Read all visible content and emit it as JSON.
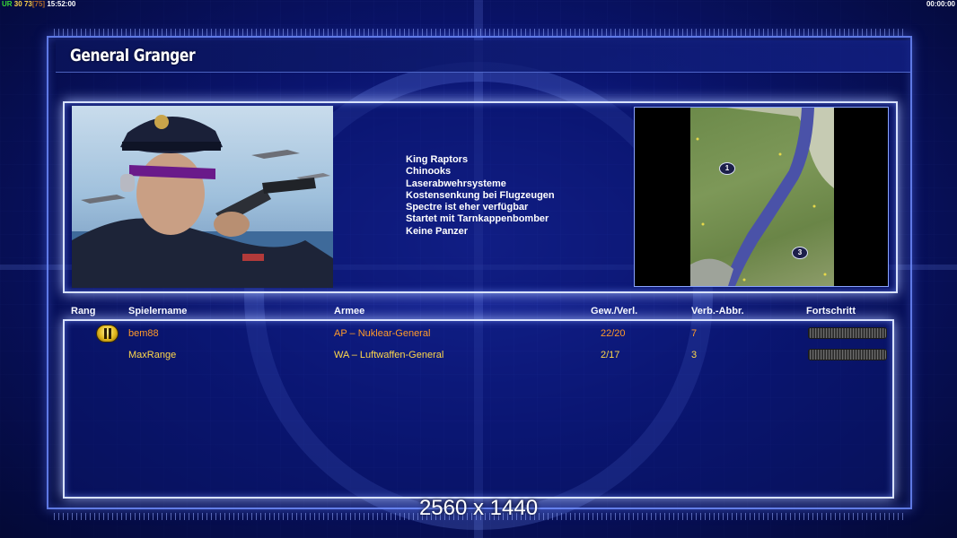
{
  "hud": {
    "code": "UR",
    "val1": "30",
    "val2": "73",
    "val3": "[75]",
    "clock": "15:52:00",
    "timer": "00:00:00"
  },
  "general": {
    "name": "General Granger",
    "traits": [
      "King Raptors",
      "Chinooks",
      "Laserabwehrsysteme",
      "Kostensenkung bei Flugzeugen",
      "Spectre ist eher verfügbar",
      "Startet mit Tarnkappenbomber",
      "Keine Panzer"
    ]
  },
  "map": {
    "spawns": [
      "1",
      "3"
    ]
  },
  "table": {
    "headers": {
      "rank": "Rang",
      "player": "Spielername",
      "army": "Armee",
      "winloss": "Gew./Verl.",
      "disconnect": "Verb.-Abbr.",
      "progress": "Fortschritt"
    },
    "rows": [
      {
        "player": "bem88",
        "army": "AP – Nuklear-General",
        "winloss": "22/20",
        "disconnect": "7",
        "color": "#ff9a2a"
      },
      {
        "player": "MaxRange",
        "army": "WA – Luftwaffen-General",
        "winloss": "2/17",
        "disconnect": "3",
        "color": "#ffd84a"
      }
    ]
  },
  "overlay": {
    "resolution": "2560 x 1440"
  },
  "colors": {
    "frame": "#d8e2ff",
    "background": "#0a1470",
    "row1": "#ff9a2a",
    "row2": "#ffd84a"
  }
}
